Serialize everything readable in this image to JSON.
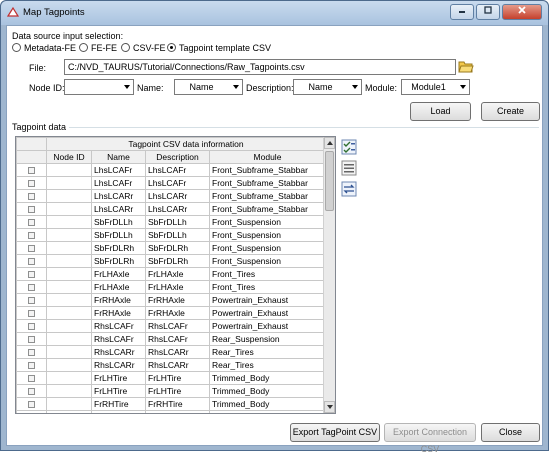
{
  "window": {
    "title": "Map Tagpoints"
  },
  "source": {
    "label": "Data source input selection:",
    "options": [
      "Metadata-FE",
      "FE-FE",
      "CSV-FE",
      "Tagpoint template CSV"
    ],
    "selected": "Tagpoint template CSV"
  },
  "file": {
    "label": "File:",
    "value": "C:/NVD_TAURUS/Tutorial/Connections/Raw_Tagpoints.csv"
  },
  "filters": {
    "node_id_label": "Node ID:",
    "node_id_value": "",
    "name_label": "Name:",
    "name_value": "Name",
    "description_label": "Description:",
    "description_value": "Name",
    "module_label": "Module:",
    "module_value": "Module1"
  },
  "buttons": {
    "load": "Load",
    "create": "Create",
    "export_tagpoint": "Export TagPoint CSV",
    "export_connection": "Export Connection CSV",
    "close": "Close"
  },
  "tagpoint": {
    "section_label": "Tagpoint data",
    "table_title": "Tagpoint CSV data information",
    "columns": [
      "Node ID",
      "Name",
      "Description",
      "Module"
    ],
    "rows": [
      [
        "",
        "LhsLCAFr",
        "LhsLCAFr",
        "Front_Subframe_Stabbar"
      ],
      [
        "",
        "LhsLCAFr",
        "LhsLCAFr",
        "Front_Subframe_Stabbar"
      ],
      [
        "",
        "LhsLCARr",
        "LhsLCARr",
        "Front_Subframe_Stabbar"
      ],
      [
        "",
        "LhsLCARr",
        "LhsLCARr",
        "Front_Subframe_Stabbar"
      ],
      [
        "",
        "SbFrDLLh",
        "SbFrDLLh",
        "Front_Suspension"
      ],
      [
        "",
        "SbFrDLLh",
        "SbFrDLLh",
        "Front_Suspension"
      ],
      [
        "",
        "SbFrDLRh",
        "SbFrDLRh",
        "Front_Suspension"
      ],
      [
        "",
        "SbFrDLRh",
        "SbFrDLRh",
        "Front_Suspension"
      ],
      [
        "",
        "FrLHAxle",
        "FrLHAxle",
        "Front_Tires"
      ],
      [
        "",
        "FrLHAxle",
        "FrLHAxle",
        "Front_Tires"
      ],
      [
        "",
        "FrRHAxle",
        "FrRHAxle",
        "Powertrain_Exhaust"
      ],
      [
        "",
        "FrRHAxle",
        "FrRHAxle",
        "Powertrain_Exhaust"
      ],
      [
        "",
        "RhsLCAFr",
        "RhsLCAFr",
        "Powertrain_Exhaust"
      ],
      [
        "",
        "RhsLCAFr",
        "RhsLCAFr",
        "Rear_Suspension"
      ],
      [
        "",
        "RhsLCARr",
        "RhsLCARr",
        "Rear_Tires"
      ],
      [
        "",
        "RhsLCARr",
        "RhsLCARr",
        "Rear_Tires"
      ],
      [
        "",
        "FrLHTire",
        "FrLHTire",
        "Trimmed_Body"
      ],
      [
        "",
        "FrLHTire",
        "FrLHTire",
        "Trimmed_Body"
      ],
      [
        "",
        "FrRHTire",
        "FrRHTire",
        "Trimmed_Body"
      ],
      [
        "",
        "FrRHTire",
        "FrRHTire",
        "Trimmed_Body"
      ]
    ]
  },
  "icons": {
    "check_all": "check-all-icon",
    "list": "list-icon",
    "swap": "swap-icon"
  }
}
